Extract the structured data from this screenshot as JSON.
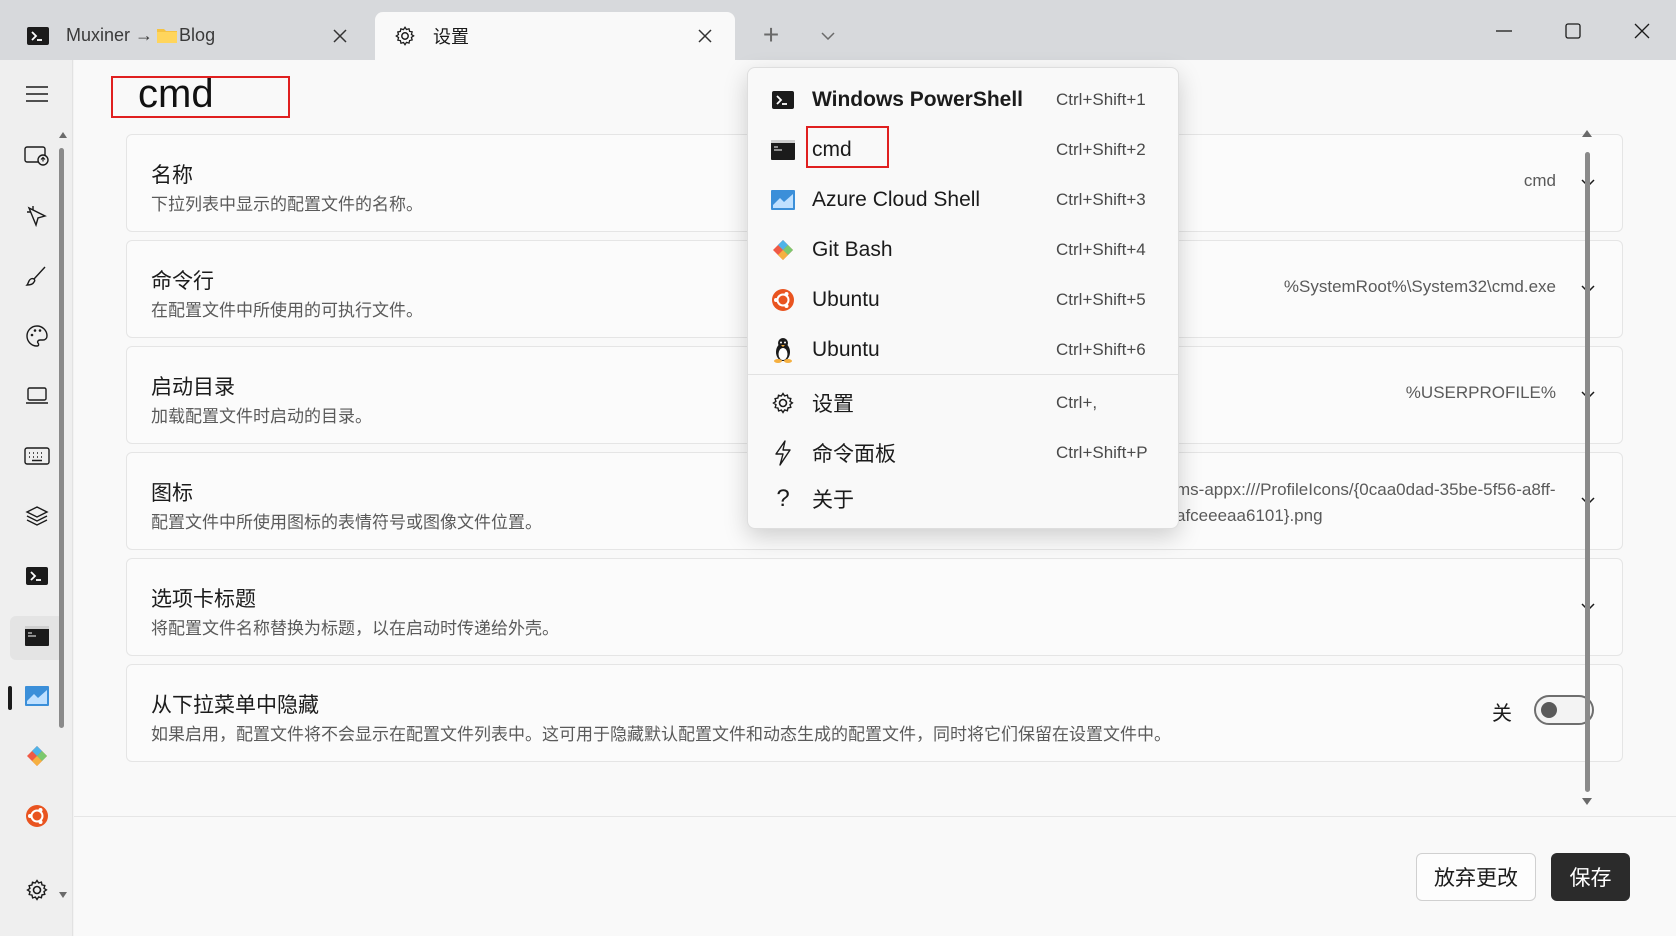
{
  "tabs": [
    {
      "icon": "terminal-icon",
      "prefix": "Muxiner",
      "arrow": "→",
      "folder_label": "Blog"
    },
    {
      "icon": "gear-icon",
      "label": "设置"
    }
  ],
  "titlebar": {
    "new_tab": "+"
  },
  "page": {
    "title": "cmd"
  },
  "settings": [
    {
      "title": "名称",
      "desc": "下拉列表中显示的配置文件的名称。",
      "value": "cmd"
    },
    {
      "title": "命令行",
      "desc": "在配置文件中所使用的可执行文件。",
      "value": "%SystemRoot%\\System32\\cmd.exe"
    },
    {
      "title": "启动目录",
      "desc": "加载配置文件时启动的目录。",
      "value": "%USERPROFILE%"
    },
    {
      "title": "图标",
      "desc": "配置文件中所使用图标的表情符号或图像文件位置。",
      "value": "ms-appx:///ProfileIcons/{0caa0dad-35be-5f56-a8ff-afceeeaa6101}.png"
    },
    {
      "title": "选项卡标题",
      "desc": "将配置文件名称替换为标题，以在启动时传递给外壳。",
      "value": ""
    },
    {
      "title": "从下拉菜单中隐藏",
      "desc": "如果启用，配置文件将不会显示在配置文件列表中。这可用于隐藏默认配置文件和动态生成的配置文件，同时将它们保留在设置文件中。",
      "toggle_label": "关",
      "toggle_on": false
    }
  ],
  "buttons": {
    "discard": "放弃更改",
    "save": "保存"
  },
  "menu": {
    "items": [
      {
        "label": "Windows PowerShell",
        "shortcut": "Ctrl+Shift+1",
        "icon": "powershell-icon"
      },
      {
        "label": "cmd",
        "shortcut": "Ctrl+Shift+2",
        "icon": "cmd-icon"
      },
      {
        "label": "Azure Cloud Shell",
        "shortcut": "Ctrl+Shift+3",
        "icon": "azure-icon"
      },
      {
        "label": "Git Bash",
        "shortcut": "Ctrl+Shift+4",
        "icon": "git-icon"
      },
      {
        "label": "Ubuntu",
        "shortcut": "Ctrl+Shift+5",
        "icon": "ubuntu-icon"
      },
      {
        "label": "Ubuntu",
        "shortcut": "Ctrl+Shift+6",
        "icon": "linux-penguin-icon"
      },
      {
        "label": "设置",
        "shortcut": "Ctrl+,",
        "icon": "gear-icon"
      },
      {
        "label": "命令面板",
        "shortcut": "Ctrl+Shift+P",
        "icon": "lightning-icon"
      },
      {
        "label": "关于",
        "shortcut": "",
        "icon": "question-icon"
      }
    ]
  },
  "colors": {
    "highlight": "#e02020",
    "ubuntu": "#e95420",
    "save_bg": "#2b2b2b"
  }
}
